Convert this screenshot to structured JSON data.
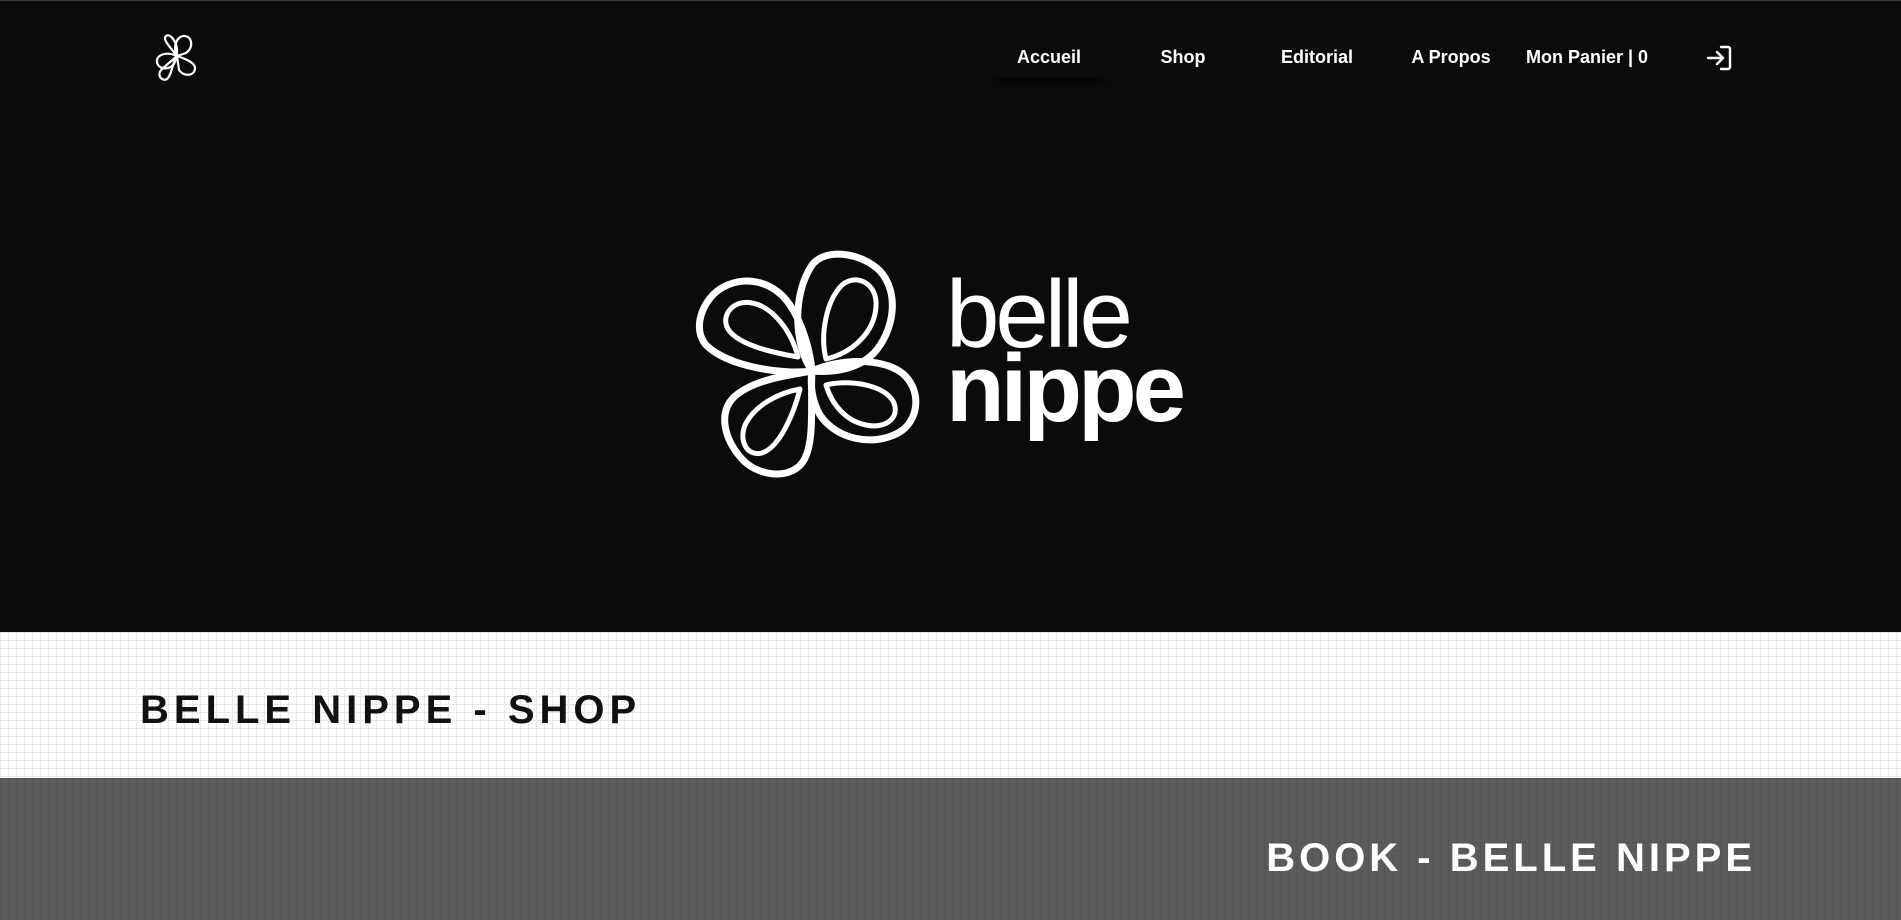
{
  "header": {
    "logo_icon": "clover-logo-icon",
    "nav": [
      {
        "label": "Accueil",
        "active": true
      },
      {
        "label": "Shop"
      },
      {
        "label": "Editorial"
      },
      {
        "label": "A Propos"
      },
      {
        "label": "Mon Panier | 0"
      }
    ],
    "login_icon": "sign-in-icon"
  },
  "hero": {
    "brand_icon": "clover-flower-icon",
    "brand_line1": "belle",
    "brand_line2": "nippe"
  },
  "sections": {
    "shop_title": "BELLE NIPPE - SHOP",
    "book_title": "BOOK - BELLE NIPPE"
  },
  "colors": {
    "hero_bg": "#0c0b0a",
    "shop_bg": "#ffffff",
    "book_bg": "#5c5b5a",
    "text_light": "#ffffff",
    "text_dark": "#111111"
  }
}
